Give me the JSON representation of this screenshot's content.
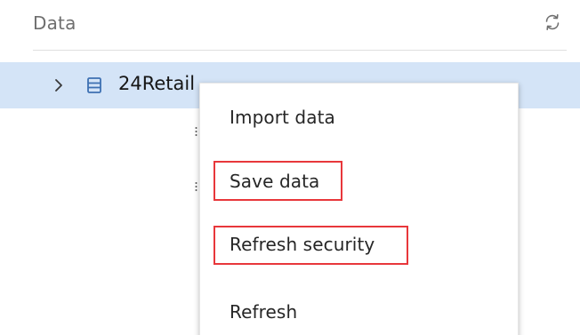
{
  "panel": {
    "title": "Data",
    "refresh_icon": "refresh-icon"
  },
  "tree": {
    "node_label": "24Retail",
    "expand_icon": "chevron-right-icon",
    "node_icon": "database-icon"
  },
  "context_menu": {
    "items": [
      {
        "label": "Import data",
        "highlighted": false
      },
      {
        "label": "Save data",
        "highlighted": true
      },
      {
        "label": "Refresh security",
        "highlighted": true
      },
      {
        "label": "Refresh",
        "highlighted": false
      }
    ],
    "highlight_color": "#e8373b"
  },
  "colors": {
    "selected_row": "#d4e4f7",
    "icon_blue": "#3d70b2"
  }
}
